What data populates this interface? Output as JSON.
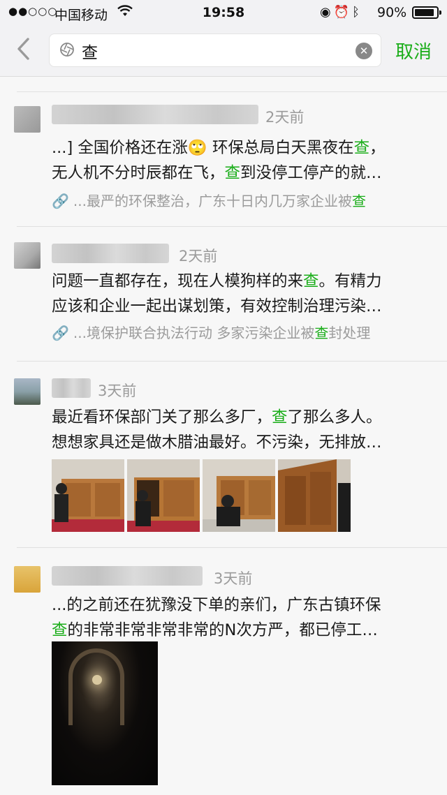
{
  "status_bar": {
    "signal": "●●○○○",
    "carrier": "中国移动",
    "wifi_icon": "wifi-icon",
    "time": "19:58",
    "battery_percent": "90%",
    "battery_level": 0.9
  },
  "search": {
    "query": "查",
    "cancel_label": "取消"
  },
  "results": [
    {
      "time": "2天前",
      "line1": [
        "...] 全国价格还在涨🙄 环保总局白天黑夜在",
        "查",
        "，"
      ],
      "line2": [
        "无人机不分时辰都在飞，",
        "查",
        "到没停工停产的就…"
      ],
      "link": [
        "...最严的环保整治，广东十日内几万家企业被",
        "查",
        ""
      ]
    },
    {
      "time": "2天前",
      "line1": [
        "问题一直都存在，现在人模狗样的来",
        "查",
        "。有精力"
      ],
      "line2": [
        "应该和企业一起出谋划策，有效控制治理污染…",
        "",
        ""
      ],
      "link": [
        "...境保护联合执法行动 多家污染企业被",
        "查",
        "封处理"
      ]
    },
    {
      "time": "3天前",
      "line1": [
        "最近看环保部门关了那么多厂，",
        "查",
        "了那么多人。"
      ],
      "line2": [
        "想想家具还是做木腊油最好。不污染，无排放…",
        "",
        ""
      ]
    },
    {
      "time": "3天前",
      "line1": [
        "...的之前还在犹豫没下单的亲们，广东古镇环保",
        "",
        ""
      ],
      "line2": [
        "",
        "查",
        "的非常非常非常非常的N次方严，都已停工…"
      ]
    }
  ]
}
